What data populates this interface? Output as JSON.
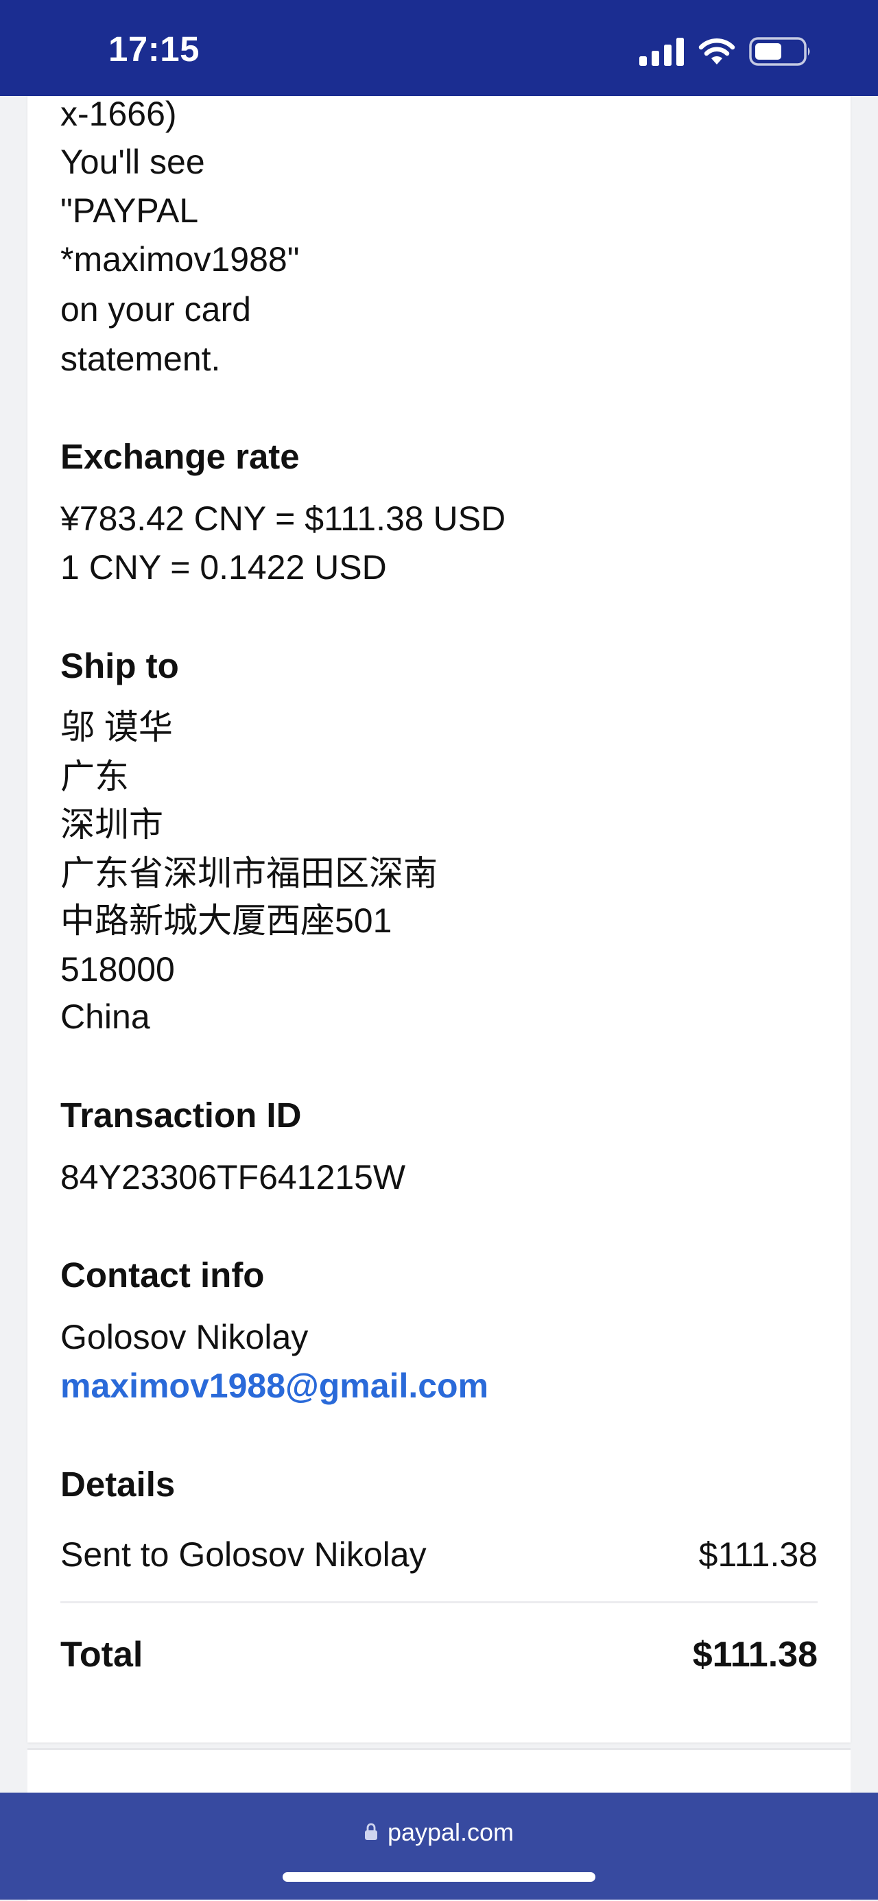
{
  "status_bar": {
    "time": "17:15"
  },
  "payment_note": {
    "lines": [
      "x-1666)",
      "You'll see",
      "\"PAYPAL",
      "*maximov1988\"",
      "on your card",
      "statement."
    ]
  },
  "exchange_rate": {
    "heading": "Exchange rate",
    "conversion": "¥783.42 CNY = $111.38 USD",
    "rate": "1 CNY = 0.1422 USD"
  },
  "ship_to": {
    "heading": "Ship to",
    "lines": [
      "邬 谟华",
      "广东",
      "深圳市",
      "广东省深圳市福田区深南",
      "中路新城大厦西座501",
      "518000",
      "China"
    ]
  },
  "transaction": {
    "heading": "Transaction ID",
    "id": "84Y23306TF641215W"
  },
  "contact_info": {
    "heading": "Contact info",
    "name": "Golosov Nikolay",
    "email": "maximov1988@gmail.com"
  },
  "details": {
    "heading": "Details",
    "sent_label": "Sent to Golosov Nikolay",
    "sent_amount": "$111.38",
    "total_label": "Total",
    "total_amount": "$111.38"
  },
  "browser": {
    "url": "paypal.com"
  },
  "colors": {
    "status_bar_bg": "#1b2d91",
    "browser_bar_bg": "#374aa0",
    "link": "#2a6ad9"
  },
  "icons": [
    "cellular-signal-icon",
    "wifi-icon",
    "battery-icon",
    "lock-icon"
  ]
}
